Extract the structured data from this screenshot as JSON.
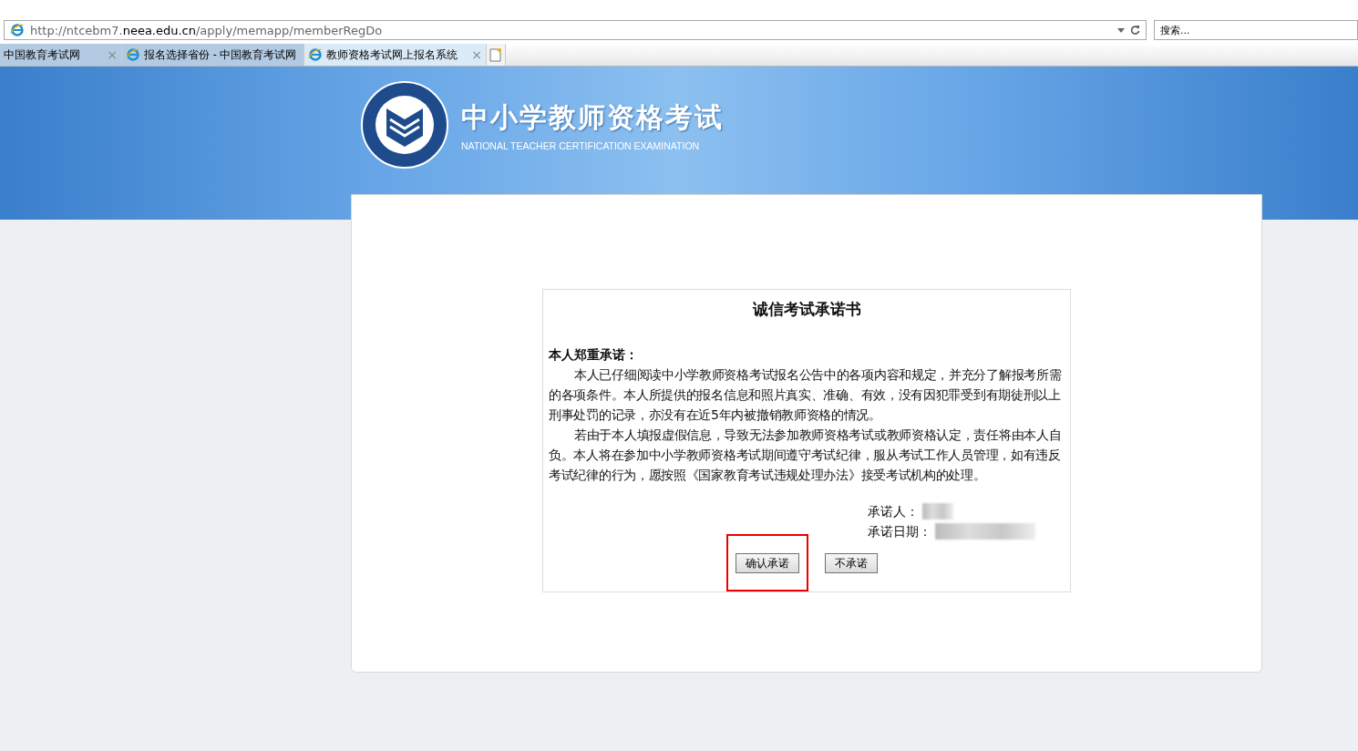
{
  "browser": {
    "address_host_prefix": "http://ntcebm7.",
    "address_host": "neea.edu.cn",
    "address_path": "/apply/memapp/memberRegDo",
    "search": {
      "placeholder": "搜索..."
    }
  },
  "tabs": [
    {
      "label": "中国教育考试网",
      "selected": false,
      "icon": false,
      "closable": true,
      "close": "×"
    },
    {
      "label": "报名选择省份 - 中国教育考试网",
      "selected": false,
      "icon": true,
      "closable": false
    },
    {
      "label": "教师资格考试网上报名系统",
      "selected": true,
      "icon": true,
      "closable": true,
      "close": "×"
    }
  ],
  "banner": {
    "title": "中小学教师资格考试",
    "subtitle": "NATIONAL TEACHER CERTIFICATION EXAMINATION"
  },
  "pledge": {
    "title": "诚信考试承诺书",
    "heading": "本人郑重承诺：",
    "paragraphs": [
      "本人已仔细阅读中小学教师资格考试报名公告中的各项内容和规定，并充分了解报考所需的各项条件。本人所提供的报名信息和照片真实、准确、有效，没有因犯罪受到有期徒刑以上刑事处罚的记录，亦没有在近5年内被撤销教师资格的情况。",
      "若由于本人填报虚假信息，导致无法参加教师资格考试或教师资格认定，责任将由本人自负。本人将在参加中小学教师资格考试期间遵守考试纪律，服从考试工作人员管理，如有违反考试纪律的行为，愿按照《国家教育考试违规处理办法》接受考试机构的处理。"
    ],
    "signer_label": "承诺人：",
    "date_label": "承诺日期：",
    "buttons": [
      {
        "label": "确认承诺",
        "highlighted": true
      },
      {
        "label": "不承诺",
        "highlighted": false
      }
    ]
  }
}
